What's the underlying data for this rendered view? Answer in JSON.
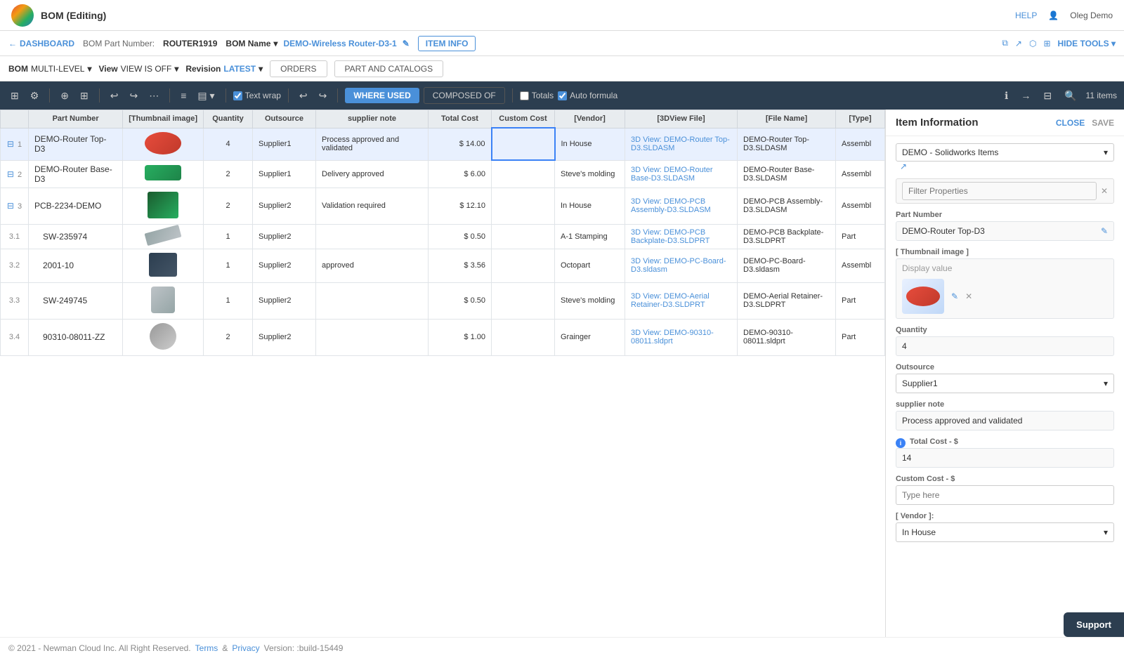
{
  "app": {
    "title": "BOM (Editing)",
    "help_label": "HELP",
    "user_label": "Oleg Demo"
  },
  "breadcrumb": {
    "dashboard": "DASHBOARD",
    "bom_part_number_label": "BOM Part Number:",
    "bom_part_number_value": "ROUTER1919",
    "bom_name_label": "BOM Name",
    "bom_name_value": "DEMO-Wireless Router-D3-1",
    "item_info_btn": "ITEM INFO",
    "hide_tools_btn": "HIDE TOOLS"
  },
  "toolbar": {
    "bom_label": "BOM",
    "bom_mode": "MULTI-LEVEL",
    "view_label": "View",
    "view_mode": "VIEW IS OFF",
    "revision_label": "Revision",
    "revision_value": "LATEST",
    "orders_tab": "ORDERS",
    "part_catalogs_tab": "PART AND CATALOGS"
  },
  "actions": {
    "where_used_btn": "WHERE USED",
    "composed_of_btn": "COMPOSED OF",
    "totals_label": "Totals",
    "auto_formula_label": "Auto formula",
    "items_count": "11 items"
  },
  "table": {
    "headers": [
      "Part Number",
      "[Thumbnail image]",
      "Quantity",
      "Outsource",
      "supplier note",
      "Total Cost",
      "Custom Cost",
      "[Vendor]",
      "[3DView File]",
      "[File Name]",
      "[Type]"
    ],
    "rows": [
      {
        "row_num": "1",
        "expand": true,
        "part_number": "DEMO-Router Top-D3",
        "quantity": "4",
        "outsource": "Supplier1",
        "supplier_note": "Process approved and validated",
        "total_cost": "$ 14.00",
        "custom_cost": "",
        "vendor": "In House",
        "view_3d_link": "3D View: DEMO-Router Top-D3.SLDASM",
        "file_name": "DEMO-Router Top-D3.SLDASM",
        "type": "Assembl",
        "thumbnail_type": "red-oval",
        "selected": true
      },
      {
        "row_num": "2",
        "expand": true,
        "part_number": "DEMO-Router Base-D3",
        "quantity": "2",
        "outsource": "Supplier1",
        "supplier_note": "Delivery approved",
        "total_cost": "$ 6.00",
        "custom_cost": "",
        "vendor": "Steve's molding",
        "view_3d_link": "3D View: DEMO-Router Base-D3.SLDASM",
        "file_name": "DEMO-Router Base-D3.SLDASM",
        "type": "Assembl",
        "thumbnail_type": "green-flat"
      },
      {
        "row_num": "3",
        "expand": true,
        "part_number": "PCB-2234-DEMO",
        "quantity": "2",
        "outsource": "Supplier2",
        "supplier_note": "Validation required",
        "total_cost": "$ 12.10",
        "custom_cost": "",
        "vendor": "In House",
        "view_3d_link": "3D View: DEMO-PCB Assembly-D3.SLDASM",
        "file_name": "DEMO-PCB Assembly-D3.SLDASM",
        "type": "Assembl",
        "thumbnail_type": "green-chip"
      },
      {
        "row_num": "3.1",
        "expand": false,
        "part_number": "SW-235974",
        "quantity": "1",
        "outsource": "Supplier2",
        "supplier_note": "",
        "total_cost": "$ 0.50",
        "custom_cost": "",
        "vendor": "A-1 Stamping",
        "view_3d_link": "3D View: DEMO-PCB Backplate-D3.SLDPRT",
        "file_name": "DEMO-PCB Backplate-D3.SLDPRT",
        "type": "Part",
        "thumbnail_type": "metal-bar"
      },
      {
        "row_num": "3.2",
        "expand": false,
        "part_number": "2001-10",
        "quantity": "1",
        "outsource": "Supplier2",
        "supplier_note": "approved",
        "total_cost": "$ 3.56",
        "custom_cost": "",
        "vendor": "Octopart",
        "view_3d_link": "3D View: DEMO-PC-Board-D3.sldasm",
        "file_name": "DEMO-PC-Board-D3.sldasm",
        "type": "Assembl",
        "thumbnail_type": "dark-chip"
      },
      {
        "row_num": "3.3",
        "expand": false,
        "part_number": "SW-249745",
        "quantity": "1",
        "outsource": "Supplier2",
        "supplier_note": "",
        "total_cost": "$ 0.50",
        "custom_cost": "",
        "vendor": "Steve's molding",
        "view_3d_link": "3D View: DEMO-Aerial Retainer-D3.SLDPRT",
        "file_name": "DEMO-Aerial Retainer-D3.SLDPRT",
        "type": "Part",
        "thumbnail_type": "silver-round"
      },
      {
        "row_num": "3.4",
        "expand": false,
        "part_number": "90310-08011-ZZ",
        "quantity": "2",
        "outsource": "Supplier2",
        "supplier_note": "",
        "total_cost": "$ 1.00",
        "custom_cost": "",
        "vendor": "Grainger",
        "view_3d_link": "3D View: DEMO-90310-08011.sldprt",
        "file_name": "DEMO-90310-08011.sldprt",
        "type": "Part",
        "thumbnail_type": "screw"
      }
    ]
  },
  "item_info_panel": {
    "title": "Item Information",
    "close_btn": "CLOSE",
    "save_btn": "SAVE",
    "filter_dropdown_value": "DEMO - Solidworks Items",
    "filter_placeholder": "Filter Properties",
    "part_number_label": "Part Number",
    "part_number_value": "DEMO-Router Top-D3",
    "thumbnail_label": "[ Thumbnail image ]",
    "thumbnail_display": "Display value",
    "quantity_label": "Quantity",
    "quantity_value": "4",
    "outsource_label": "Outsource",
    "outsource_value": "Supplier1",
    "supplier_note_label": "supplier note",
    "supplier_note_value": "Process approved and validated",
    "total_cost_label": "Total Cost - $",
    "total_cost_value": "14",
    "custom_cost_label": "Custom Cost - $",
    "custom_cost_placeholder": "Type here",
    "vendor_label": "[ Vendor ]:",
    "vendor_value": "In House"
  },
  "footer": {
    "copyright": "© 2021 - Newman Cloud Inc. All Right Reserved.",
    "terms_label": "Terms",
    "and_label": "&",
    "privacy_label": "Privacy",
    "version_label": "Version: :build-15449"
  },
  "support_btn": "Support"
}
